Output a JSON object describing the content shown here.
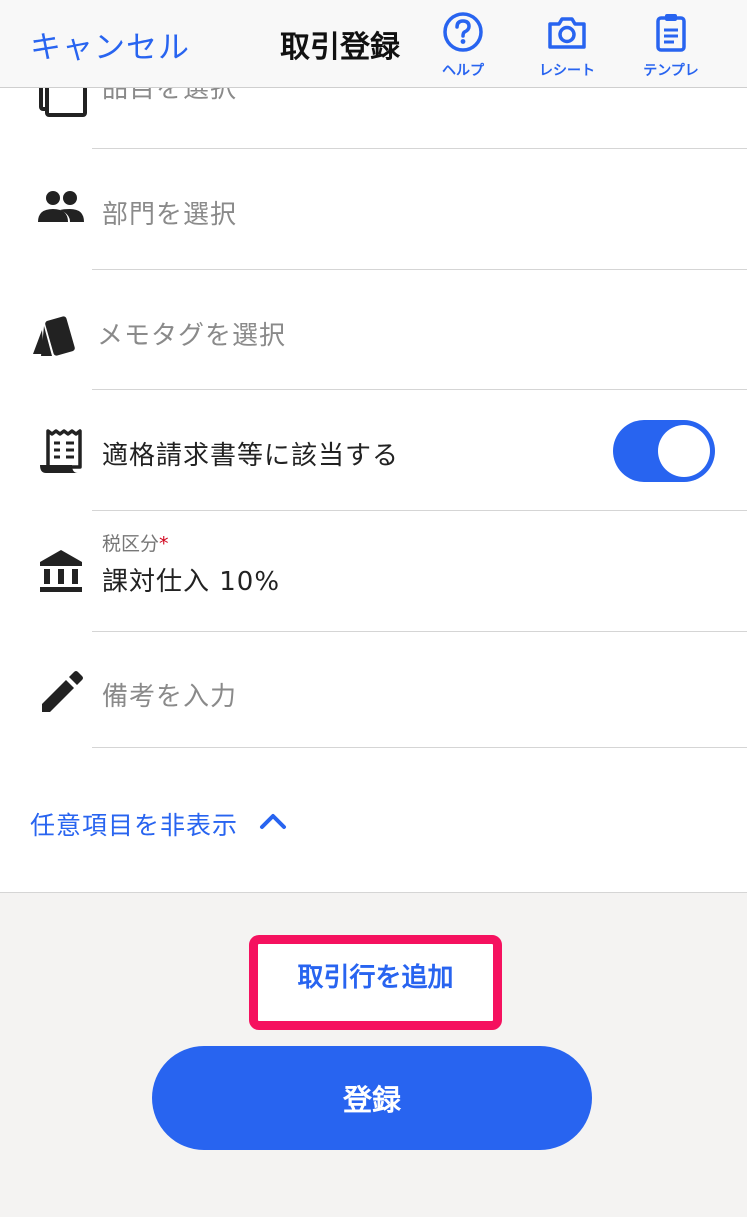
{
  "header": {
    "cancel_label": "キャンセル",
    "title": "取引登録",
    "help_label": "ヘルプ",
    "receipt_label": "レシート",
    "template_label": "テンプレ"
  },
  "form": {
    "item_placeholder": "品目を選択",
    "department_placeholder": "部門を選択",
    "memo_tag_placeholder": "メモタグを選択",
    "qualified_invoice_label": "適格請求書等に該当する",
    "qualified_invoice_on": true,
    "tax_category_label": "税区分",
    "tax_category_required_mark": "*",
    "tax_category_value": "課対仕入 10%",
    "remarks_placeholder": "備考を入力",
    "hide_optional_label": "任意項目を非表示"
  },
  "footer": {
    "add_line_label": "取引行を追加",
    "submit_label": "登録"
  },
  "colors": {
    "accent": "#2864f0",
    "highlight": "#f5115f",
    "required": "#d0021b"
  },
  "icons": [
    "help-icon",
    "camera-icon",
    "clipboard-icon",
    "item-icon",
    "people-icon",
    "tag-icon",
    "receipt-icon",
    "bank-icon",
    "pencil-icon",
    "chevron-up-icon"
  ]
}
